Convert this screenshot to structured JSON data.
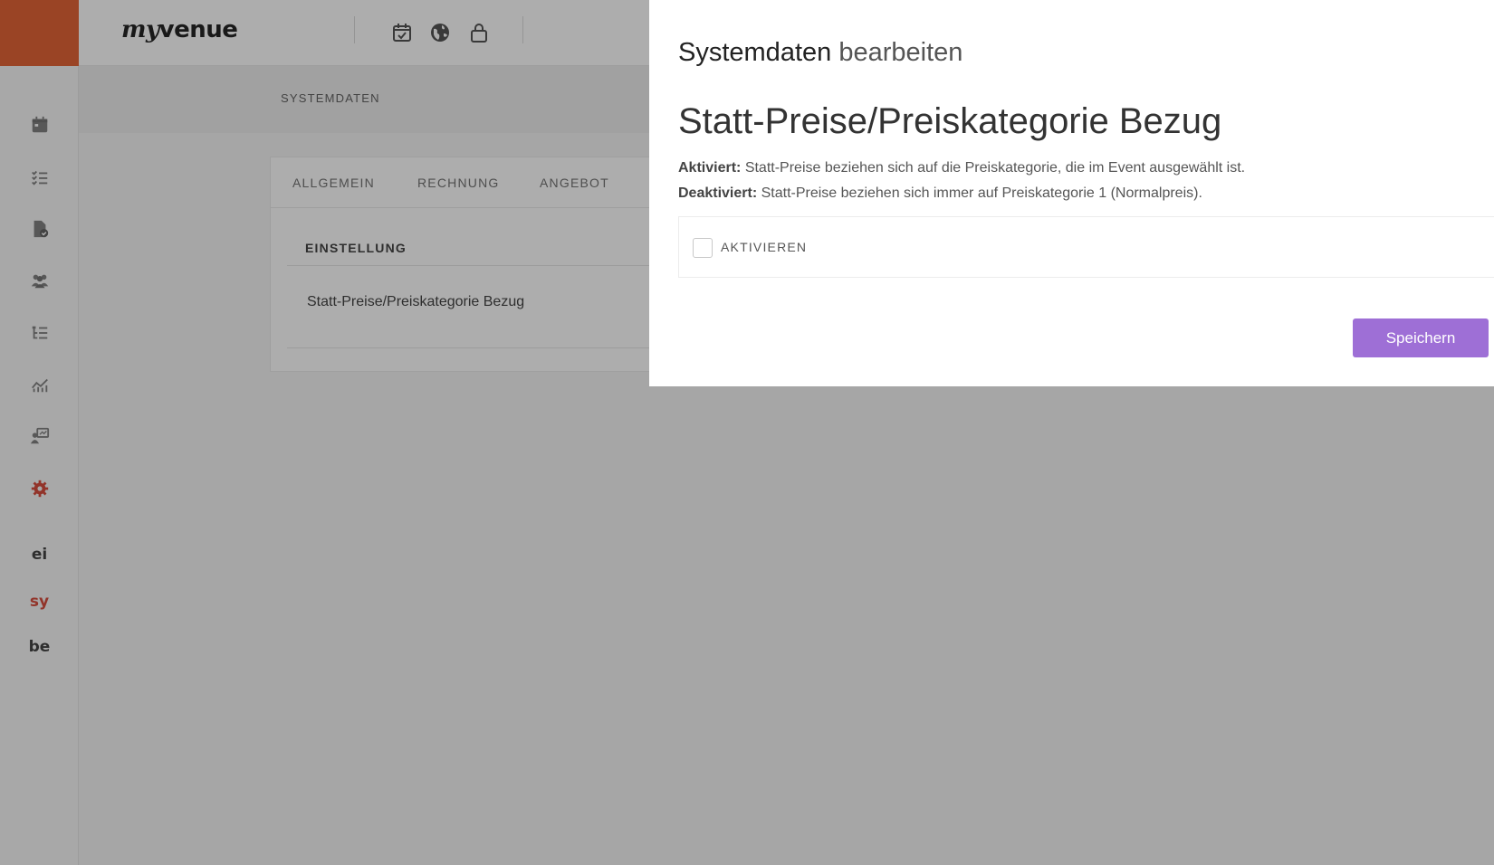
{
  "app": {
    "logo_my": "my",
    "logo_venue": "venue",
    "colors": {
      "brand": "#e05624",
      "accent_button": "#9e6fd6",
      "active_nav": "#d43d2c"
    }
  },
  "topbar": {
    "icons": [
      "calendar-check-icon",
      "globe-icon",
      "lock-icon"
    ]
  },
  "sidebar": {
    "icons": [
      "calendar-icon",
      "checklist-icon",
      "document-check-icon",
      "users-icon",
      "tree-list-icon",
      "chart-line-icon",
      "presenter-icon",
      "gear-icon"
    ],
    "text_items": [
      {
        "label": "ei",
        "active": false
      },
      {
        "label": "sy",
        "active": true
      },
      {
        "label": "be",
        "active": false
      }
    ]
  },
  "subheader": {
    "title": "SYSTEMDATEN"
  },
  "tabs": [
    "ALLGEMEIN",
    "RECHNUNG",
    "ANGEBOT"
  ],
  "table": {
    "header": "EINSTELLUNG",
    "rows": [
      "Statt-Preise/Preiskategorie Bezug"
    ]
  },
  "panel": {
    "title_strong": "Systemdaten",
    "title_light": "bearbeiten",
    "heading": "Statt-Preise/Preiskategorie Bezug",
    "activated_label": "Aktiviert:",
    "activated_text": "Statt-Preise beziehen sich auf die Preiskategorie, die im Event ausgewählt ist.",
    "deactivated_label": "Deaktiviert:",
    "deactivated_text": "Statt-Preise beziehen sich immer auf Preiskategorie 1 (Normalpreis).",
    "checkbox_label": "AKTIVIEREN",
    "checkbox_checked": false,
    "save_label": "Speichern"
  }
}
